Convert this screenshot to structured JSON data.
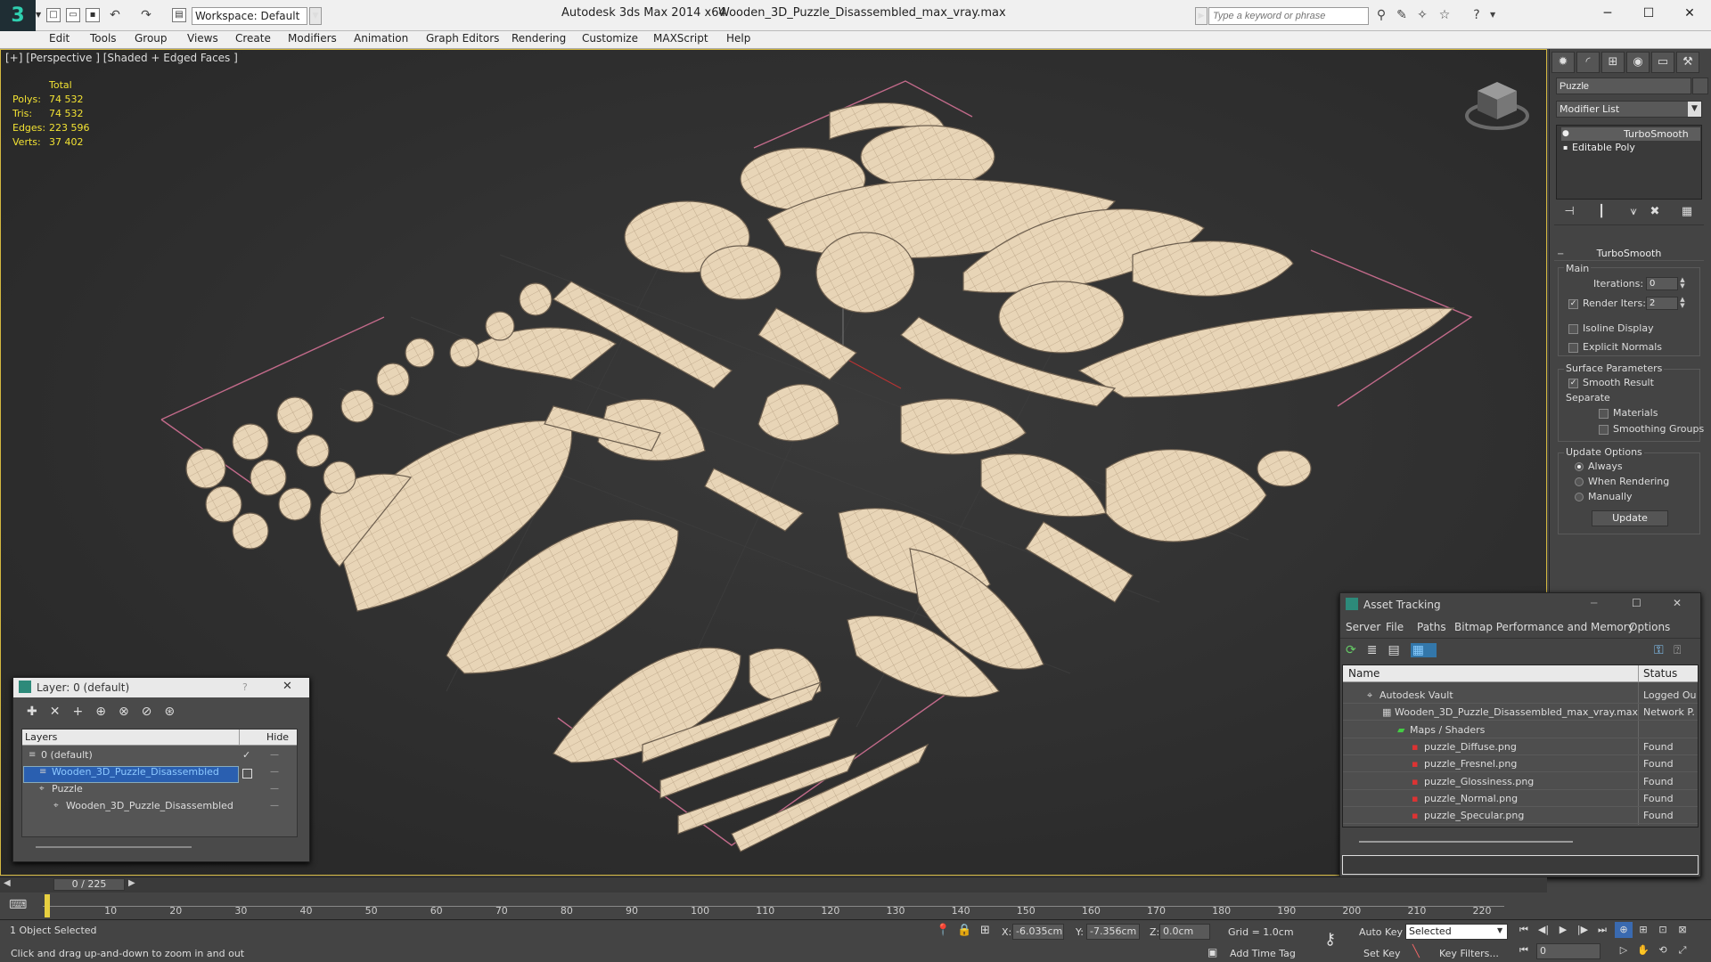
{
  "titlebar": {
    "app_title": "Autodesk 3ds Max  2014 x64",
    "file_title": "Wooden_3D_Puzzle_Disassembled_max_vray.max",
    "workspace": "Workspace: Default",
    "search_placeholder": "Type a keyword or phrase"
  },
  "menu": [
    "Edit",
    "Tools",
    "Group",
    "Views",
    "Create",
    "Modifiers",
    "Animation",
    "Graph Editors",
    "Rendering",
    "Customize",
    "MAXScript",
    "Help"
  ],
  "viewport": {
    "label": "[+] [Perspective ] [Shaded + Edged Faces ]",
    "stats": {
      "header": "Total",
      "rows": [
        {
          "label": "Polys:",
          "value": "74 532"
        },
        {
          "label": "Tris:",
          "value": "74 532"
        },
        {
          "label": "Edges:",
          "value": "223 596"
        },
        {
          "label": "Verts:",
          "value": "37 402"
        }
      ]
    }
  },
  "command_panel": {
    "object_name": "Puzzle",
    "modifier_list": "Modifier List",
    "stack": [
      "TurboSmooth",
      "Editable Poly"
    ],
    "rollout": "TurboSmooth",
    "main_label": "Main",
    "iterations_label": "Iterations:",
    "iterations_value": "0",
    "render_iters_label": "Render Iters:",
    "render_iters_value": "2",
    "isoline": "Isoline Display",
    "explicit": "Explicit Normals",
    "surface_params": "Surface Parameters",
    "smooth_result": "Smooth Result",
    "separate": "Separate",
    "materials": "Materials",
    "smoothing_groups": "Smoothing Groups",
    "update_options": "Update Options",
    "always": "Always",
    "when_rendering": "When Rendering",
    "manually": "Manually",
    "update_btn": "Update"
  },
  "layer_dialog": {
    "title": "Layer: 0 (default)",
    "help": "?",
    "col_layers": "Layers",
    "col_hide": "Hide",
    "rows": [
      {
        "name": "0 (default)"
      },
      {
        "name": "Wooden_3D_Puzzle_Disassembled"
      },
      {
        "name": "Puzzle"
      },
      {
        "name": "Wooden_3D_Puzzle_Disassembled"
      }
    ]
  },
  "asset_tracking": {
    "title": "Asset Tracking",
    "menu": [
      "Server",
      "File",
      "Paths",
      "Bitmap Performance and Memory",
      "Options"
    ],
    "col_name": "Name",
    "col_status": "Status",
    "rows": [
      {
        "name": "Autodesk Vault",
        "status": "Logged Ou"
      },
      {
        "name": "Wooden_3D_Puzzle_Disassembled_max_vray.max",
        "status": "Network P."
      },
      {
        "name": "Maps / Shaders",
        "status": ""
      },
      {
        "name": "puzzle_Diffuse.png",
        "status": "Found"
      },
      {
        "name": "puzzle_Fresnel.png",
        "status": "Found"
      },
      {
        "name": "puzzle_Glossiness.png",
        "status": "Found"
      },
      {
        "name": "puzzle_Normal.png",
        "status": "Found"
      },
      {
        "name": "puzzle_Specular.png",
        "status": "Found"
      }
    ]
  },
  "timeline": {
    "slider": "0 / 225",
    "ticks": [
      "10",
      "20",
      "30",
      "40",
      "50",
      "60",
      "70",
      "80",
      "90",
      "100",
      "110",
      "120",
      "130",
      "140",
      "150",
      "160",
      "170",
      "180",
      "190",
      "200",
      "210",
      "220"
    ]
  },
  "status": {
    "selected": "1 Object Selected",
    "hint": "Click and drag up-and-down to zoom in and out",
    "x_label": "X:",
    "x_value": "-6.035cm",
    "y_label": "Y:",
    "y_value": "-7.356cm",
    "z_label": "Z:",
    "z_value": "0.0cm",
    "grid": "Grid = 1.0cm",
    "add_time_tag": "Add Time Tag",
    "auto_key": "Auto Key",
    "auto_key_value": "Selected",
    "set_key": "Set Key",
    "key_filters": "Key Filters...",
    "frame": "0"
  }
}
